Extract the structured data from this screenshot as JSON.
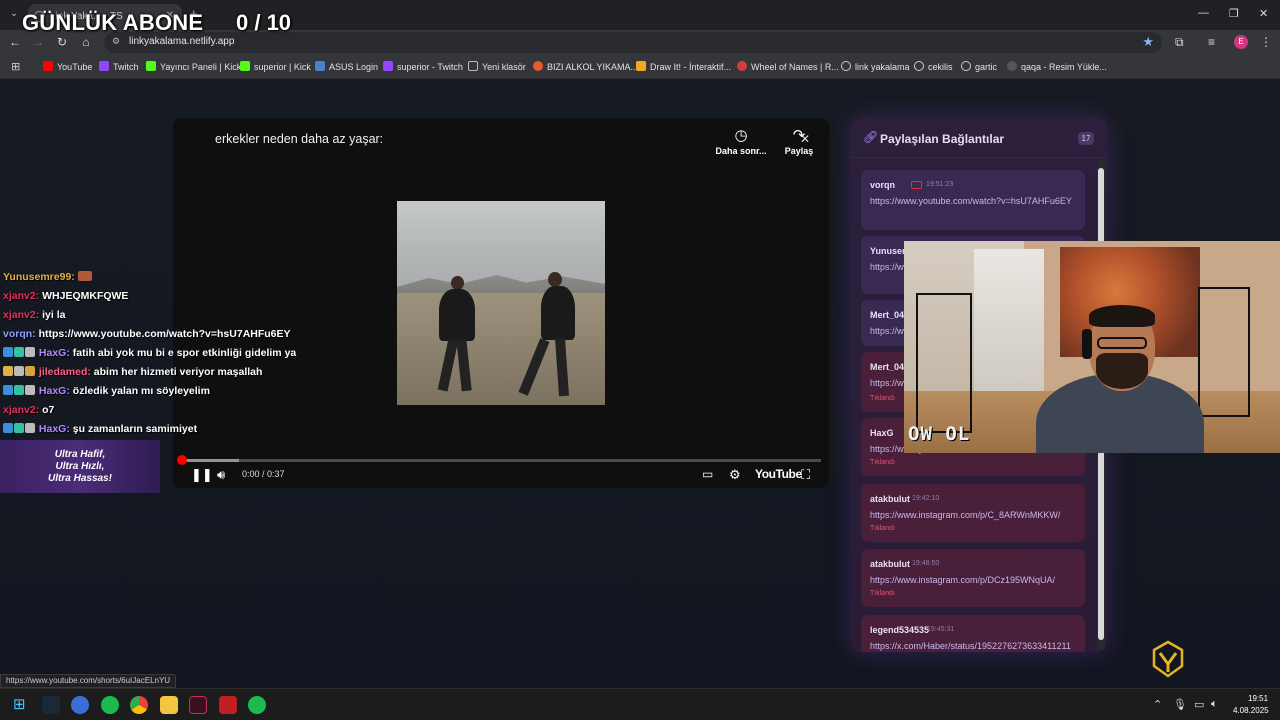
{
  "browser": {
    "tab_title": "Link Yaka... - TS",
    "new_tab": "+",
    "url": "linkyakalama.netlify.app",
    "profile_initial": "E",
    "bookmarks": [
      "YouTube",
      "Twitch",
      "Yayıncı Paneli | Kick",
      "superior | Kick",
      "ASUS Login",
      "superior - Twitch",
      "Yeni klasör",
      "BIZI ALKOL YIKAMA...",
      "Draw It! - İnteraktif...",
      "Wheel of Names | R...",
      "link yakalama",
      "cekilis",
      "gartic",
      "qaqa - Resim Yükle..."
    ],
    "status_url": "https://www.youtube.com/shorts/6uIJacELnYU"
  },
  "overlay": {
    "title": "GÜNLÜK ABONE",
    "counter": "0 / 10"
  },
  "player": {
    "video_title": "erkekler neden daha az yaşar:",
    "watch_later_label": "Daha sonr...",
    "share_label": "Paylaş",
    "time": "0:00 / 0:37",
    "progress": 0.0,
    "buffered": 0.09,
    "brand": "YouTube"
  },
  "chat": {
    "lines": [
      {
        "user": "Yunusemre99:",
        "msg": "",
        "color": "#e0b040"
      },
      {
        "user": "xjanv2:",
        "msg": "WHJEQMKFQWE",
        "color": "#e0305a"
      },
      {
        "user": "xjanv2:",
        "msg": "iyi la",
        "color": "#e0305a"
      },
      {
        "user": "vorqn:",
        "msg": "https://www.youtube.com/watch?v=hsU7AHFu6EY",
        "color": "#8f9fff"
      },
      {
        "user": "HaxG:",
        "msg": "fatih abi yok mu bi e spor etkinliği gidelim ya",
        "color": "#b388ff"
      },
      {
        "user": "jiledamed:",
        "msg": "abim her hizmeti veriyor maşallah",
        "color": "#ff5e8a"
      },
      {
        "user": "HaxG:",
        "msg": "özledik yalan mı söyleyelim",
        "color": "#b388ff"
      },
      {
        "user": "xjanv2:",
        "msg": "o7",
        "color": "#e0305a"
      },
      {
        "user": "HaxG:",
        "msg": "şu zamanların samimiyet",
        "color": "#b388ff"
      }
    ],
    "promo": [
      "Ultra Hafif,",
      "Ultra Hızlı,",
      "Ultra Hassas!"
    ]
  },
  "links_panel": {
    "title": "Paylaşılan Bağlantılar",
    "count": "17",
    "clicked_label": "Tıklandı",
    "cards": [
      {
        "user": "vorqn",
        "time": "19:51:23",
        "url": "https://www.youtube.com/watch?v=hsU7AHFu6EY",
        "clicked": false
      },
      {
        "user": "Yunusemre99",
        "time": "",
        "url": "https://www.youtube.com/shorts/k",
        "clicked": false
      },
      {
        "user": "Mert_04",
        "time": "",
        "url": "https://www.youtube.com/",
        "clicked": false
      },
      {
        "user": "Mert_04",
        "time": "",
        "url": "https://www.youtube.com/",
        "clicked": true
      },
      {
        "user": "HaxG",
        "time": "",
        "url": "https://www.youtube.com/",
        "clicked": true
      },
      {
        "user": "atakbulut",
        "time": "19:42:10",
        "url": "https://www.instagram.com/p/C_8ARWnMKKW/",
        "clicked": true
      },
      {
        "user": "atakbulut",
        "time": "19:48:50",
        "url": "https://www.instagram.com/p/DCz195WNqUA/",
        "clicked": true
      },
      {
        "user": "legend534535",
        "time": "19:45:31",
        "url": "https://x.com/Haber/status/1952276273633411211",
        "clicked": true
      }
    ]
  },
  "webcam": {
    "label": "OW OL"
  },
  "taskbar": {
    "time": "19:51",
    "date": "4.08.2025"
  },
  "colors": {
    "accent_purple": "#b38ef0",
    "clicked_red": "#e05575",
    "yt_red": "#ff0000"
  }
}
